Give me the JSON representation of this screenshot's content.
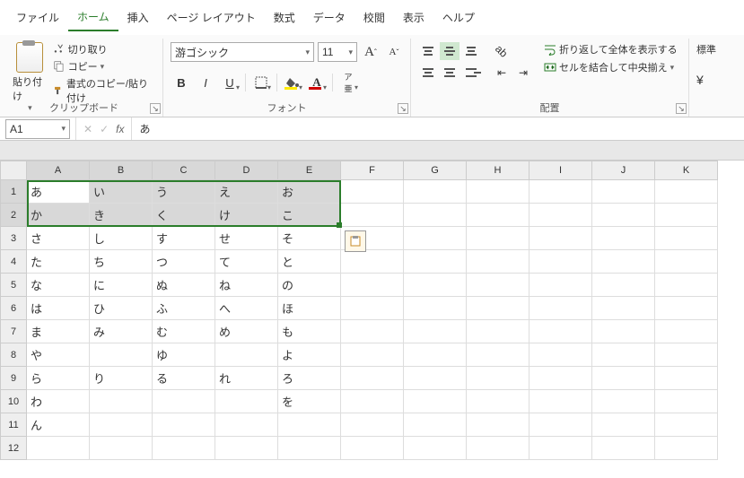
{
  "menu": {
    "items": [
      "ファイル",
      "ホーム",
      "挿入",
      "ページ レイアウト",
      "数式",
      "データ",
      "校閲",
      "表示",
      "ヘルプ"
    ],
    "active_index": 1
  },
  "ribbon": {
    "clipboard": {
      "title": "クリップボード",
      "paste_label": "貼り付け",
      "cut_label": "切り取り",
      "copy_label": "コピー",
      "format_painter_label": "書式のコピー/貼り付け"
    },
    "font": {
      "title": "フォント",
      "font_name": "游ゴシック",
      "font_size": "11",
      "bold": "B",
      "italic": "I",
      "underline": "U",
      "grow": "A",
      "shrink": "A"
    },
    "alignment": {
      "title": "配置",
      "wrap_label": "折り返して全体を表示する",
      "merge_label": "セルを結合して中央揃え"
    },
    "number": {
      "title": "標準"
    }
  },
  "formula_bar": {
    "cell_ref": "A1",
    "fx": "fx",
    "value": "あ"
  },
  "sheet": {
    "column_letters": [
      "A",
      "B",
      "C",
      "D",
      "E",
      "F",
      "G",
      "H",
      "I",
      "J",
      "K"
    ],
    "row_numbers": [
      "1",
      "2",
      "3",
      "4",
      "5",
      "6",
      "7",
      "8",
      "9",
      "10",
      "11",
      "12"
    ],
    "selected_cols": [
      0,
      1,
      2,
      3,
      4
    ],
    "selected_rows": [
      0,
      1
    ],
    "active_cell": {
      "row": 0,
      "col": 0
    },
    "data": [
      [
        "あ",
        "い",
        "う",
        "え",
        "お",
        "",
        "",
        "",
        "",
        "",
        ""
      ],
      [
        "か",
        "き",
        "く",
        "け",
        "こ",
        "",
        "",
        "",
        "",
        "",
        ""
      ],
      [
        "さ",
        "し",
        "す",
        "せ",
        "そ",
        "",
        "",
        "",
        "",
        "",
        ""
      ],
      [
        "た",
        "ち",
        "つ",
        "て",
        "と",
        "",
        "",
        "",
        "",
        "",
        ""
      ],
      [
        "な",
        "に",
        "ぬ",
        "ね",
        "の",
        "",
        "",
        "",
        "",
        "",
        ""
      ],
      [
        "は",
        "ひ",
        "ふ",
        "へ",
        "ほ",
        "",
        "",
        "",
        "",
        "",
        ""
      ],
      [
        "ま",
        "み",
        "む",
        "め",
        "も",
        "",
        "",
        "",
        "",
        "",
        ""
      ],
      [
        "や",
        "",
        "ゆ",
        "",
        "よ",
        "",
        "",
        "",
        "",
        "",
        ""
      ],
      [
        "ら",
        "り",
        "る",
        "れ",
        "ろ",
        "",
        "",
        "",
        "",
        "",
        ""
      ],
      [
        "わ",
        "",
        "",
        "",
        "を",
        "",
        "",
        "",
        "",
        "",
        ""
      ],
      [
        "ん",
        "",
        "",
        "",
        "",
        "",
        "",
        "",
        "",
        "",
        ""
      ],
      [
        "",
        "",
        "",
        "",
        "",
        "",
        "",
        "",
        "",
        "",
        ""
      ]
    ]
  }
}
